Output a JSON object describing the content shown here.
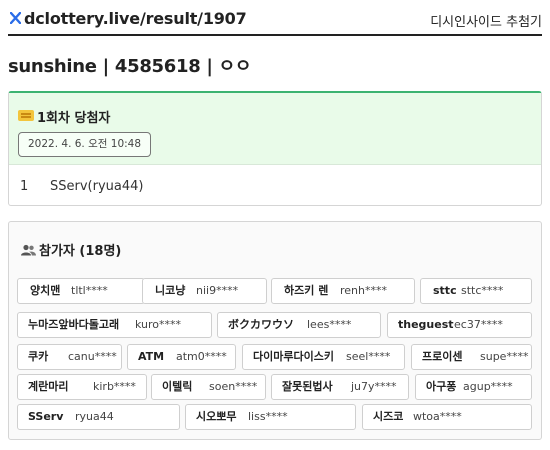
{
  "header": {
    "logo_icon": "x-logo-icon",
    "url": "dclottery.live/result/1907",
    "nav_label": "디시인사이드 추첨기"
  },
  "page_title": "sunshine | 4585618 | ㅇㅇ",
  "result": {
    "heading": "1회차 당첨자",
    "icon": "ticket-icon",
    "date": "2022. 4. 6. 오전 10:48",
    "winners": [
      {
        "rank": "1",
        "name": "SServ(ryua44)"
      }
    ]
  },
  "participants": {
    "heading": "참가자 (18명)",
    "icon": "people-icon",
    "list": [
      {
        "nick": "양치맨",
        "id": "tltl****"
      },
      {
        "nick": "니코냥",
        "id": "nii9****"
      },
      {
        "nick": "하즈키 렌",
        "id": "renh****"
      },
      {
        "nick": "sttc",
        "id": "sttc****"
      },
      {
        "nick": "누마즈앞바다돌고래",
        "id": "kuro****"
      },
      {
        "nick": "ボクカワウソ",
        "id": "lees****"
      },
      {
        "nick": "theguest",
        "id": "ec37****"
      },
      {
        "nick": "쿠카",
        "id": "canu****"
      },
      {
        "nick": "ATM",
        "id": "atm0****"
      },
      {
        "nick": "다이마루다이스키",
        "id": "seel****"
      },
      {
        "nick": "프로이센",
        "id": "supe****"
      },
      {
        "nick": "계란마리",
        "id": "kirb****"
      },
      {
        "nick": "이텔릭",
        "id": "soen****"
      },
      {
        "nick": "잘못된법사",
        "id": "ju7y****"
      },
      {
        "nick": "아구퐁",
        "id": "agup****"
      },
      {
        "nick": "SServ",
        "id": "ryua44"
      },
      {
        "nick": "시오뽀무",
        "id": "liss****"
      },
      {
        "nick": "시즈코",
        "id": "wtoa****"
      }
    ]
  }
}
